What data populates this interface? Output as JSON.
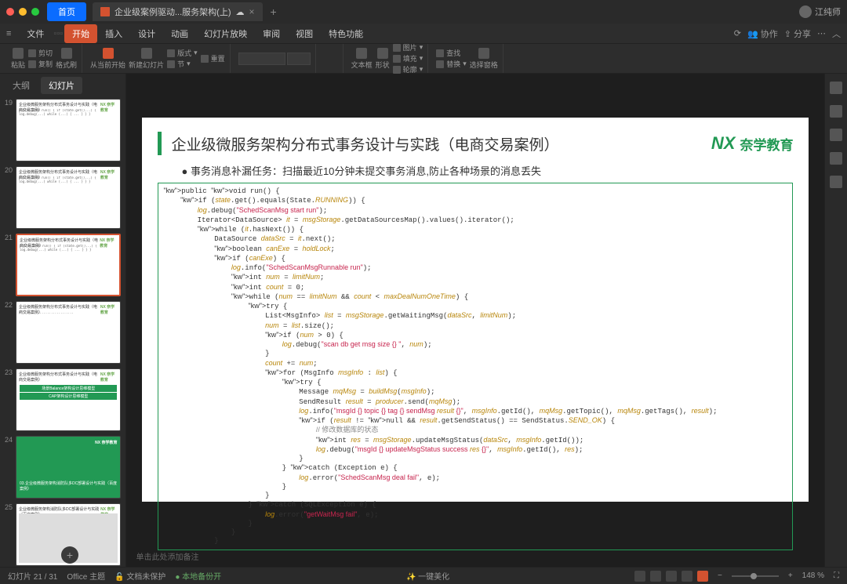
{
  "titlebar": {
    "home_tab": "首页",
    "doc_tab": "企业级案例驱动...服务架构(上)",
    "cloud_indicator": "☁",
    "close": "×",
    "add": "+",
    "username": "江纯师"
  },
  "menubar": {
    "items": [
      "文件",
      "开始",
      "插入",
      "设计",
      "动画",
      "幻灯片放映",
      "审阅",
      "视图",
      "特色功能"
    ],
    "active_index": 1,
    "collaborate": "协作",
    "share": "分享"
  },
  "ribbon": {
    "paste": "粘贴",
    "cut": "剪切",
    "copy": "复制",
    "format_painter": "格式刷",
    "new_slide_from": "从当前开始",
    "new_slide": "新建幻灯片",
    "layout": "版式",
    "section": "节",
    "reset": "重置",
    "textbox": "文本框",
    "shapes": "形状",
    "image": "图片",
    "fill": "填充",
    "outline": "轮廓",
    "find": "查找",
    "replace": "替换",
    "select_pane": "选择窗格"
  },
  "slidepanel": {
    "tabs": {
      "outline": "大纲",
      "slides": "幻灯片"
    },
    "thumbs": [
      {
        "num": 19,
        "title": "企业级微服务架构分布式事务设计与实践（电商交易案例）",
        "brand": "NX 奈学教育",
        "kind": "code"
      },
      {
        "num": 20,
        "title": "企业级微服务架构分布式事务设计与实践（电商交易案例）",
        "brand": "NX 奈学教育",
        "kind": "code"
      },
      {
        "num": 21,
        "title": "企业级微服务架构分布式事务设计与实践（电商交易案例）",
        "brand": "NX 奈学教育",
        "kind": "code",
        "active": true
      },
      {
        "num": 22,
        "title": "企业级微服务架构分布式事务设计与实践（电商交易案例）",
        "brand": "NX 奈学教育",
        "kind": "text"
      },
      {
        "num": 23,
        "title": "企业级微服务架构分布式事务设计与实践（电商交易案例）",
        "brand": "NX 奈学教育",
        "kind": "green2",
        "lines": [
          "场景Balance架构设计思维模型",
          "CAP架构设计思维模型"
        ]
      },
      {
        "num": 24,
        "title": "",
        "brand": "NX 奈学教育",
        "kind": "greenfull",
        "line": "03.企业级微服务架构消防队多DC部署设计与实践（百度案例）"
      },
      {
        "num": 25,
        "title": "企业级微服务架构消防队多DC部署设计与实践（百度案例）",
        "brand": "NX 奈学教育",
        "kind": "img"
      }
    ],
    "add": "+"
  },
  "slide": {
    "title": "企业级微服务架构分布式事务设计与实践（电商交易案例）",
    "logo_text": "奈学教育",
    "logo_nx": "NX",
    "bullet": "事务消息补漏任务：扫描最近10分钟未提交事务消息,防止各种场景的消息丢失",
    "code": "public void run() {\n    if (state.get().equals(State.RUNNING)) {\n        log.debug(\"SchedScanMsg start run\");\n        Iterator<DataSource> it = msgStorage.getDataSourcesMap().values().iterator();\n        while (it.hasNext()) {\n            DataSource dataSrc = it.next();\n            boolean canExe = holdLock;\n            if (canExe) {\n                log.info(\"SchedScanMsgRunnable run\");\n                int num = limitNum;\n                int count = 0;\n                while (num == limitNum && count < maxDealNumOneTime) {\n                    try {\n                        List<MsgInfo> list = msgStorage.getWaitingMsg(dataSrc, limitNum);\n                        num = list.size();\n                        if (num > 0) {\n                            log.debug(\"scan db get msg size {} \", num);\n                        }\n                        count += num;\n                        for (MsgInfo msgInfo : list) {\n                            try {\n                                Message mqMsg = buildMsg(msgInfo);\n                                SendResult result = producer.send(mqMsg);\n                                log.info(\"msgId {} topic {} tag {} sendMsg result {}\", msgInfo.getId(), mqMsg.getTopic(), mqMsg.getTags(), result);\n                                if (result != null && result.getSendStatus() == SendStatus.SEND_OK) {\n                                    // 修改数据库的状态\n                                    int res = msgStorage.updateMsgStatus(dataSrc, msgInfo.getId());\n                                    log.debug(\"msgId {} updateMsgStatus success res {}\", msgInfo.getId(), res);\n                                }\n                            } catch (Exception e) {\n                                log.error(\"SchedScanMsg deal fail\", e);\n                            }\n                        }\n                    } catch (SQLException e) {\n                        log.error(\"getWaitMsg fail\", e);\n                    }\n                }\n            }"
  },
  "notes_placeholder": "单击此处添加备注",
  "statusbar": {
    "slide_indicator": "幻灯片 21 / 31",
    "theme": "Office 主题",
    "protect": "文档未保护",
    "backup": "本地备份开",
    "beautify": "一键美化",
    "zoom": "148 %"
  }
}
